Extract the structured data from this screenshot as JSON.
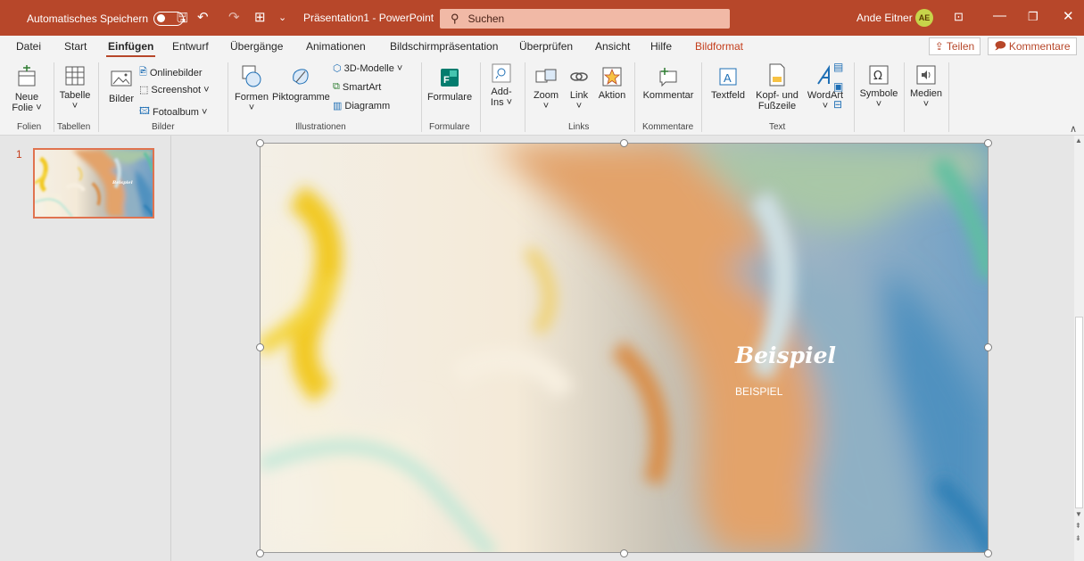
{
  "titlebar": {
    "autosave_label": "Automatisches Speichern",
    "doc_title": "Präsentation1 - PowerPoint",
    "search_placeholder": "Suchen",
    "user_name": "Ande Eitner",
    "user_initials": "AE",
    "qat_save": "🖫",
    "qat_undo": "↶",
    "qat_redo": "↷",
    "qat_start": "⊞",
    "qat_more": "⌄",
    "win_ribbon": "⊡",
    "win_min": "—",
    "win_restore": "❐",
    "win_close": "✕"
  },
  "tabs": [
    "Datei",
    "Start",
    "Einfügen",
    "Entwurf",
    "Übergänge",
    "Animationen",
    "Bildschirmpräsentation",
    "Überprüfen",
    "Ansicht",
    "Hilfe",
    "Bildformat"
  ],
  "active_tab": "Einfügen",
  "share_label": "Teilen",
  "comments_label": "Kommentare",
  "ribbon": {
    "neue_folie": "Neue",
    "neue_folie2": "Folie ˅",
    "tabelle": "Tabelle",
    "bilder": "Bilder",
    "onlinebilder": "Onlinebilder",
    "screenshot": "Screenshot ˅",
    "fotoalbum": "Fotoalbum ˅",
    "formen": "Formen",
    "piktogramme": "Piktogramme",
    "modelle3d": "3D-Modelle ˅",
    "smartart": "SmartArt",
    "diagramm": "Diagramm",
    "formulare": "Formulare",
    "addins": "Add-",
    "addins2": "Ins ˅",
    "zoom": "Zoom",
    "link": "Link",
    "aktion": "Aktion",
    "kommentar": "Kommentar",
    "textfeld": "Textfeld",
    "kopfzeile": "Kopf- und",
    "kopfzeile2": "Fußzeile",
    "wordart": "WordArt",
    "symbole": "Symbole",
    "medien": "Medien",
    "dropdown": "˅"
  },
  "groups": {
    "folien": "Folien",
    "tabellen": "Tabellen",
    "bilder": "Bilder",
    "illustrationen": "Illustrationen",
    "formulare": "Formulare",
    "links": "Links",
    "kommentare": "Kommentare",
    "text": "Text"
  },
  "thumbnail": {
    "number": "1",
    "title": "Beispiel"
  },
  "slide": {
    "title": "Beispiel",
    "subtitle": "BEISPIEL"
  },
  "colors": {
    "accent": "#b7472a",
    "ribbon_bg": "#f3f3f3",
    "search_bg": "#f1b9a6"
  }
}
